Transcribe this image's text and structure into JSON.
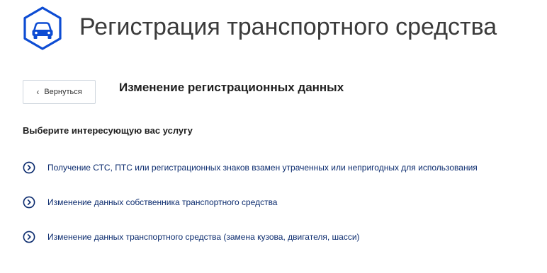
{
  "header": {
    "title": "Регистрация транспортного средства",
    "logo_icon": "car-icon",
    "accent_color": "#0d4cd3"
  },
  "back_button": {
    "label": "Вернуться",
    "icon": "chevron-left-icon"
  },
  "section": {
    "title": "Изменение регистрационных данных"
  },
  "prompt": "Выберите интересующую вас услугу",
  "services": [
    {
      "label": "Получение СТС, ПТС или регистрационных знаков взамен утраченных или непригодных для использования",
      "icon": "chevron-right-circle-icon"
    },
    {
      "label": "Изменение данных собственника транспортного средства",
      "icon": "chevron-right-circle-icon"
    },
    {
      "label": "Изменение данных транспортного средства (замена кузова, двигателя, шасси)",
      "icon": "chevron-right-circle-icon"
    }
  ]
}
